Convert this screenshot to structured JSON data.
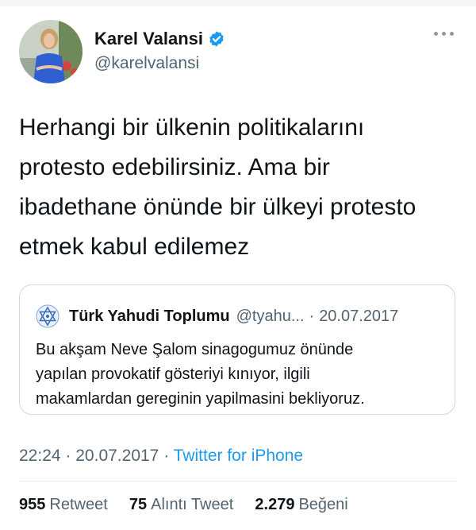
{
  "author": {
    "name": "Karel Valansi",
    "handle": "@karelvalansi",
    "verified": true
  },
  "icons": {
    "verified": "verified-badge-icon",
    "more": "more-options-icon",
    "quote_logo": "star-of-david-logo-icon"
  },
  "tweet": {
    "lines": [
      "Herhangi bir ülkenin politikalarını",
      "protesto edebilirsiniz. Ama bir",
      "ibadethane önünde bir ülkeyi protesto",
      "etmek kabul edilemez"
    ]
  },
  "quote": {
    "name": "Türk Yahudi Toplumu",
    "handle": "@tyahu...",
    "separator": "·",
    "date": "20.07.2017",
    "lines": [
      "Bu akşam Neve Şalom sinagogumuz önünde",
      "yapılan provokatif gösteriyi kınıyor, ilgili",
      "makamlardan gereginin yapilmasini bekliyoruz."
    ]
  },
  "meta": {
    "time": "22:24",
    "separator": "·",
    "date": "20.07.2017",
    "source": "Twitter for iPhone"
  },
  "stats": {
    "retweets": "955",
    "retweets_label": "Retweet",
    "quotes": "75",
    "quotes_label": "Alıntı Tweet",
    "likes": "2.279",
    "likes_label": "Beğeni"
  },
  "colors": {
    "accent": "#1d9bf0",
    "text": "#0f1419",
    "muted": "#536471",
    "border": "#cfd9de"
  }
}
